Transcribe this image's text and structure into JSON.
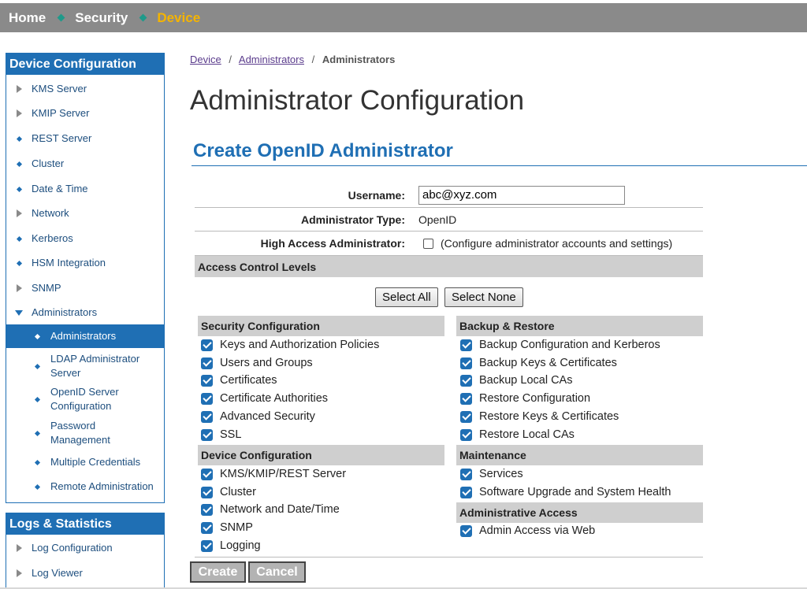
{
  "topnav": [
    {
      "label": "Home",
      "active": false
    },
    {
      "label": "Security",
      "active": false
    },
    {
      "label": "Device",
      "active": true
    }
  ],
  "sidebar": {
    "device_title": "Device Configuration",
    "items": [
      {
        "label": "KMS Server",
        "icon": "arrow-right-icon"
      },
      {
        "label": "KMIP Server",
        "icon": "arrow-right-icon"
      },
      {
        "label": "REST Server",
        "icon": "bullet-icon"
      },
      {
        "label": "Cluster",
        "icon": "bullet-icon"
      },
      {
        "label": "Date & Time",
        "icon": "bullet-icon"
      },
      {
        "label": "Network",
        "icon": "arrow-right-icon"
      },
      {
        "label": "Kerberos",
        "icon": "bullet-icon"
      },
      {
        "label": "HSM Integration",
        "icon": "bullet-icon"
      },
      {
        "label": "SNMP",
        "icon": "arrow-right-icon"
      },
      {
        "label": "Administrators",
        "icon": "arrow-down-icon"
      }
    ],
    "sub_items": [
      {
        "label": "Administrators",
        "active": true
      },
      {
        "label": "LDAP Administrator Server"
      },
      {
        "label": "OpenID Server Configuration"
      },
      {
        "label": "Password Management"
      },
      {
        "label": "Multiple Credentials"
      },
      {
        "label": "Remote Administration"
      }
    ],
    "logs_title": "Logs & Statistics",
    "log_items": [
      {
        "label": "Log Configuration",
        "icon": "arrow-right-icon"
      },
      {
        "label": "Log Viewer",
        "icon": "arrow-right-icon"
      }
    ]
  },
  "breadcrumb": {
    "items": [
      "Device",
      "Administrators",
      "Administrators"
    ],
    "separator": "/"
  },
  "page_title": "Administrator Configuration",
  "section_title": "Create OpenID Administrator",
  "form": {
    "username_label": "Username:",
    "username_value": "abc@xyz.com",
    "admin_type_label": "Administrator Type:",
    "admin_type_value": "OpenID",
    "high_access_label": "High Access Administrator:",
    "high_access_note": "(Configure administrator accounts and settings)",
    "high_access_checked": false
  },
  "acl": {
    "title": "Access Control Levels",
    "select_all": "Select All",
    "select_none": "Select None",
    "left_groups": [
      {
        "title": "Security Configuration",
        "items": [
          "Keys and Authorization Policies",
          "Users and Groups",
          "Certificates",
          "Certificate Authorities",
          "Advanced Security",
          "SSL"
        ]
      },
      {
        "title": "Device Configuration",
        "items": [
          "KMS/KMIP/REST Server",
          "Cluster",
          "Network and Date/Time",
          "SNMP",
          "Logging"
        ]
      }
    ],
    "right_groups": [
      {
        "title": "Backup & Restore",
        "items": [
          "Backup Configuration and Kerberos",
          "Backup Keys & Certificates",
          "Backup Local CAs",
          "Restore Configuration",
          "Restore Keys & Certificates",
          "Restore Local CAs"
        ]
      },
      {
        "title": "Maintenance",
        "items": [
          "Services",
          "Software Upgrade and System Health"
        ]
      },
      {
        "title": "Administrative Access",
        "items": [
          "Admin Access via Web"
        ]
      }
    ]
  },
  "actions": {
    "create": "Create",
    "cancel": "Cancel"
  },
  "colors": {
    "accent": "#1f6fb4",
    "nav_bg": "#8a8a8a",
    "nav_active": "#f5b400"
  }
}
